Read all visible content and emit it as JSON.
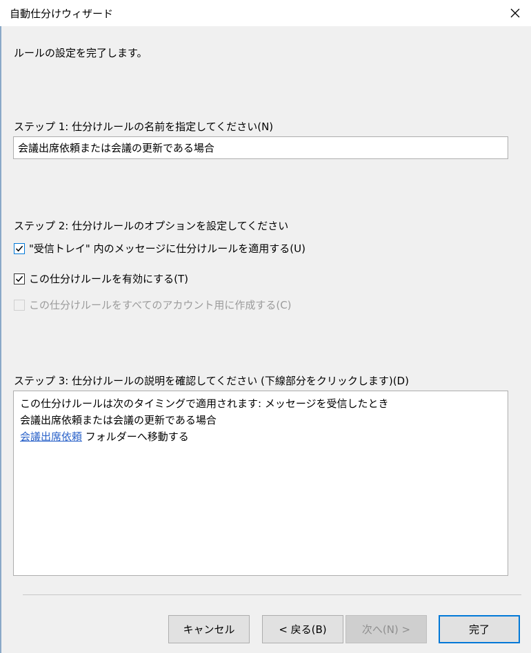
{
  "window": {
    "title": "自動仕分けウィザード"
  },
  "intro_text": "ルールの設定を完了します。",
  "step1": {
    "label": "ステップ 1: 仕分けルールの名前を指定してください(N)",
    "value": "会議出席依頼または会議の更新である場合"
  },
  "step2": {
    "label": "ステップ 2: 仕分けルールのオプションを設定してください",
    "options": [
      {
        "label": "\"受信トレイ\" 内のメッセージに仕分けルールを適用する(U)",
        "checked": true,
        "enabled": true
      },
      {
        "label": "この仕分けルールを有効にする(T)",
        "checked": true,
        "enabled": true
      },
      {
        "label": "この仕分けルールをすべてのアカウント用に作成する(C)",
        "checked": false,
        "enabled": false
      }
    ]
  },
  "step3": {
    "label": "ステップ 3: 仕分けルールの説明を確認してください (下線部分をクリックします)(D)",
    "line1": "この仕分けルールは次のタイミングで適用されます: メッセージを受信したとき",
    "line2": "会議出席依頼または会議の更新である場合",
    "line3_link": "会議出席依頼",
    "line3_rest": " フォルダーへ移動する"
  },
  "buttons": {
    "cancel": "キャンセル",
    "back": "< 戻る(B)",
    "next": "次へ(N) >",
    "finish": "完了"
  },
  "colors": {
    "accent": "#0078d7",
    "link": "#2a62c9"
  }
}
